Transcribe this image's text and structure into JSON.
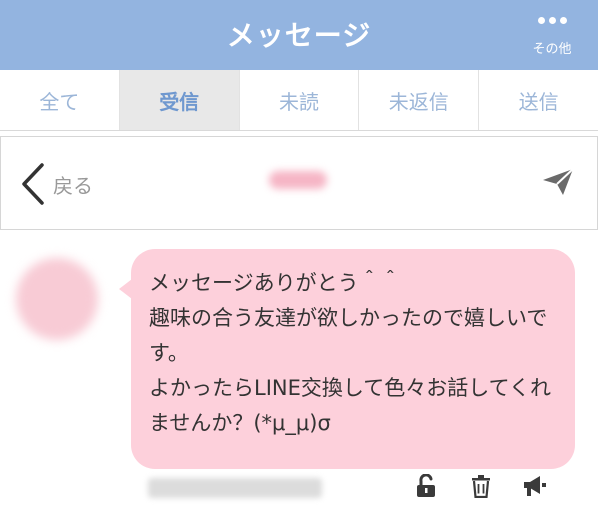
{
  "header": {
    "title": "メッセージ",
    "more_label": "その他",
    "more_icon": "more-dots-icon"
  },
  "tabs": [
    {
      "label": "全て",
      "active": false
    },
    {
      "label": "受信",
      "active": true
    },
    {
      "label": "未読",
      "active": false
    },
    {
      "label": "未返信",
      "active": false
    },
    {
      "label": "送信",
      "active": false
    }
  ],
  "toolbar": {
    "back_label": "戻る",
    "back_icon": "chevron-left-icon",
    "send_icon": "paper-plane-icon"
  },
  "message": {
    "text": "メッセージありがとう＾＾\n趣味の合う友達が欲しかったので嬉しいです。\nよかったらLINE交換して色々お話してくれませんか？(*μ_μ)σ"
  },
  "actions": {
    "unlock_icon": "unlock-icon",
    "delete_icon": "trash-icon",
    "report_icon": "megaphone-icon"
  },
  "colors": {
    "header_bg": "#93b4e0",
    "tab_text": "#9cb6d8",
    "active_tab_bg": "#e8e8e8",
    "bubble_bg": "#fdd0db"
  }
}
